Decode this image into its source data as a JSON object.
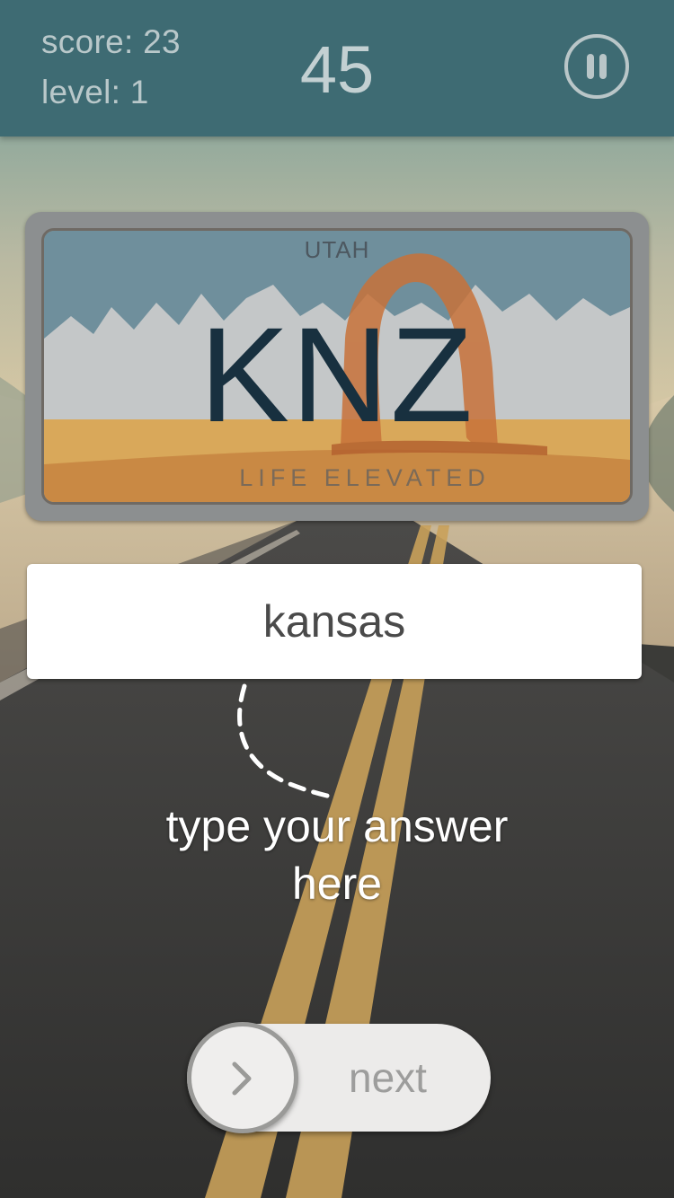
{
  "header": {
    "score": "score: 23",
    "level": "level: 1",
    "timer": "45"
  },
  "plate": {
    "state": "UTAH",
    "number": "KNZ",
    "slogan": "LIFE ELEVATED"
  },
  "answer": {
    "value": "kansas"
  },
  "hint": {
    "line1": "type your answer",
    "line2": "here"
  },
  "next_button": {
    "label": "next"
  },
  "icons": {
    "pause": "pause-icon",
    "next": "chevron-right-icon",
    "arch": "delicate-arch-icon"
  },
  "colors": {
    "header": "#3e6b73",
    "plate_text": "#18303f",
    "arch": "#c8723a"
  }
}
